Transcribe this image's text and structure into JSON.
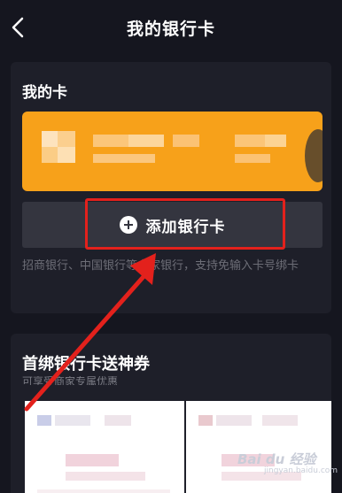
{
  "header": {
    "title": "我的银行卡"
  },
  "my_cards": {
    "title": "我的卡",
    "add_button_label": "添加银行卡",
    "support_text": "招商银行、中国银行等多家银行，支持免输入卡号绑卡"
  },
  "promo": {
    "title": "首绑银行卡送神券",
    "subtitle": "可享受商家专属优惠"
  },
  "watermark": {
    "brand": "Bai du 经验",
    "url": "jingyan.baidu.com"
  },
  "colors": {
    "background": "#15161f",
    "panel": "#1e1f29",
    "card": "#f7a11a",
    "button": "#34353f",
    "highlight": "#e3211c",
    "muted_text": "#6d6e77"
  }
}
